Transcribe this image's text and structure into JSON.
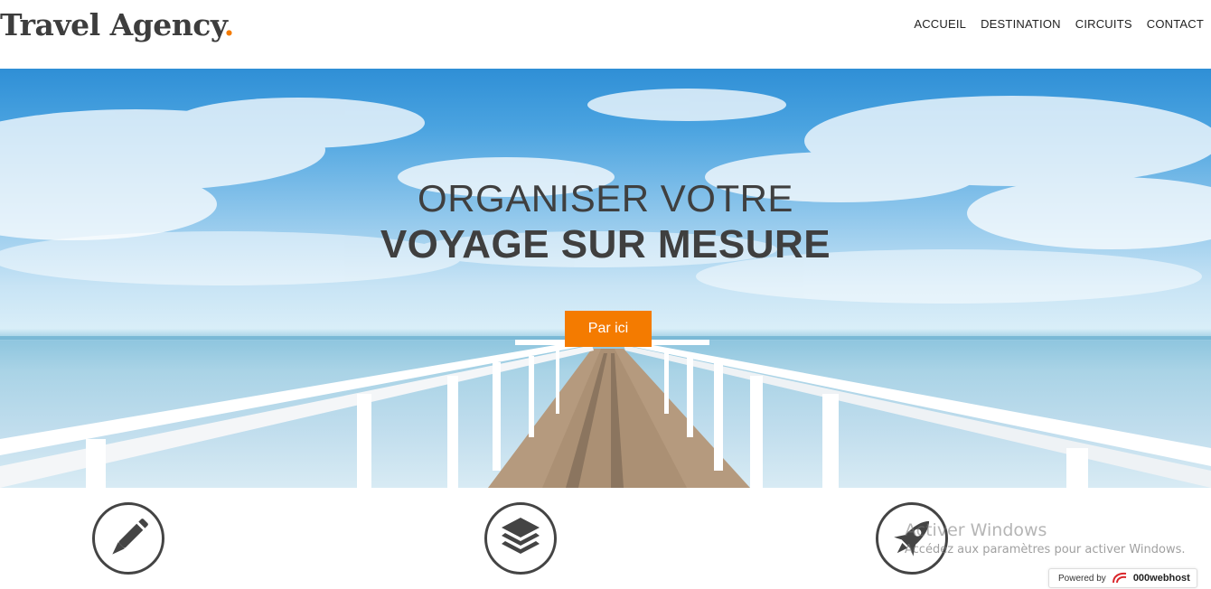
{
  "header": {
    "logo_text": "Travel Agency",
    "logo_dot": ".",
    "nav": [
      {
        "label": "ACCUEIL"
      },
      {
        "label": "DESTINATION"
      },
      {
        "label": "CIRCUITS"
      },
      {
        "label": "CONTACT"
      }
    ]
  },
  "hero": {
    "title_line1": "ORGANISER VOTRE",
    "title_line2": "VOYAGE SUR MESURE",
    "cta_label": "Par ici"
  },
  "features": [
    {
      "icon": "pen-icon"
    },
    {
      "icon": "layers-icon"
    },
    {
      "icon": "rocket-icon"
    }
  ],
  "watermark": {
    "title": "Activer Windows",
    "subtitle": "Accédez aux paramètres pour activer Windows."
  },
  "badge": {
    "powered_label": "Powered by",
    "brand": "000webhost"
  },
  "colors": {
    "accent": "#f47b00",
    "text": "#3f3f3f"
  }
}
